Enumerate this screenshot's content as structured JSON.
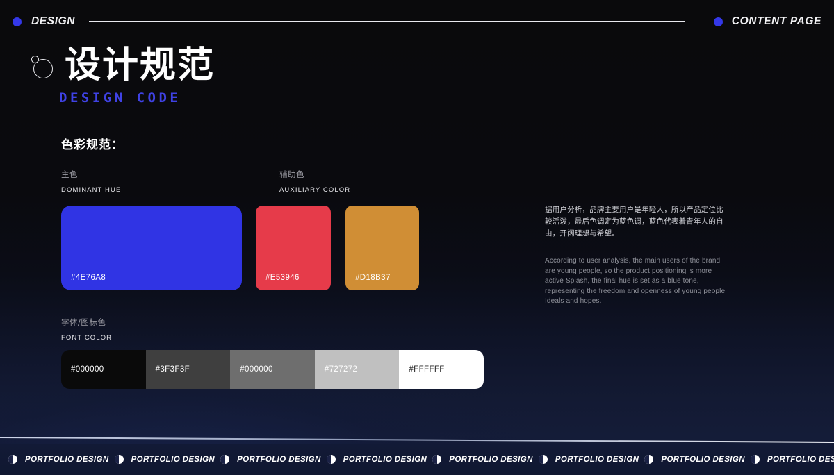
{
  "header": {
    "left_label": "DESIGN",
    "right_label": "CONTENT PAGE",
    "accent_color": "#3438E8"
  },
  "title": {
    "heading_cn": "设计规范",
    "heading_en": "DESIGN CODE",
    "heading_en_color": "#3F42E4",
    "logo_icon": "circle-with-pip-icon"
  },
  "section": {
    "title": "色彩规范："
  },
  "groups": {
    "dominant": {
      "cn": "主色",
      "en": "DOMINANT HUE"
    },
    "auxiliary": {
      "cn": "辅助色",
      "en": "AUXILIARY COLOR"
    },
    "font": {
      "cn": "字体/图标色",
      "en": "FONT  COLOR"
    }
  },
  "swatches": {
    "dominant": {
      "label": "#4E76A8",
      "fill": "#3034E4"
    },
    "auxiliary": [
      {
        "label": "#E53946",
        "fill": "#E63B4A"
      },
      {
        "label": "#D18B37",
        "fill": "#D08E35"
      }
    ]
  },
  "gray_scale": [
    {
      "label": "#000000",
      "fill": "#0A0A0A",
      "text_color": "#FFFFFF"
    },
    {
      "label": "#3F3F3F",
      "fill": "#3F3F3F",
      "text_color": "#FFFFFF"
    },
    {
      "label": "#000000",
      "fill": "#6E6E6E",
      "text_color": "#FFFFFF"
    },
    {
      "label": "#727272",
      "fill": "#C0C0C0",
      "text_color": "#FFFFFF"
    },
    {
      "label": "#FFFFFF",
      "fill": "#FFFFFF",
      "text_color": "#2A2A2A"
    }
  ],
  "description": {
    "cn": "据用户分析，品牌主要用户是年轻人，所以产品定位比较活泼，最后色调定为蓝色调，蓝色代表着青年人的自由，开阔理想与希望。",
    "en": "According to user analysis, the main users of the brand are young people, so the product positioning is more active Splash, the final hue is set as a blue tone, representing the freedom and openness of young people Ideals and hopes."
  },
  "footer": {
    "items": [
      {
        "label": "PORTFOLIO DESIGN",
        "icon": "half-moon-icon"
      },
      {
        "label": "PORTFOLIO DESIGN",
        "icon": "half-moon-icon"
      },
      {
        "label": "PORTFOLIO DESIGN",
        "icon": "half-moon-icon"
      },
      {
        "label": "PORTFOLIO DESIGN",
        "icon": "half-moon-icon"
      },
      {
        "label": "PORTFOLIO DESIGN",
        "icon": "half-moon-icon"
      },
      {
        "label": "PORTFOLIO DESIGN",
        "icon": "half-moon-icon"
      },
      {
        "label": "PORTFOLIO DESIGN",
        "icon": "half-moon-icon"
      },
      {
        "label": "PORTFOLIO DESIGN",
        "icon": "half-moon-icon"
      }
    ]
  }
}
